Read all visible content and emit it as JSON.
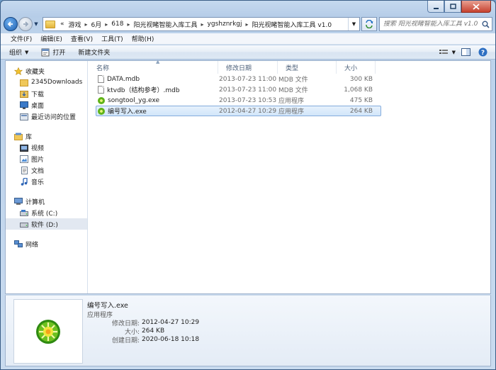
{
  "address": {
    "overflow": "«",
    "crumbs": [
      "游戏",
      "6月",
      "618",
      "阳光视睹智能入库工具",
      "ygshznrkgj",
      "阳光视睹智能入库工具 v1.0"
    ]
  },
  "search": {
    "placeholder": "搜索 阳光视睹智能入库工具 v1.0"
  },
  "menu": [
    "文件(F)",
    "编辑(E)",
    "查看(V)",
    "工具(T)",
    "帮助(H)"
  ],
  "toolbar": {
    "organize": "组织",
    "open": "打开",
    "new_folder": "新建文件夹"
  },
  "nav": {
    "favorites": {
      "label": "收藏夹",
      "items": [
        "2345Downloads",
        "下载",
        "桌面",
        "最近访问的位置"
      ]
    },
    "libraries": {
      "label": "库",
      "items": [
        "视频",
        "图片",
        "文档",
        "音乐"
      ]
    },
    "computer": {
      "label": "计算机",
      "items": [
        "系统 (C:)",
        "软件 (D:)"
      ]
    },
    "network": {
      "label": "网络"
    }
  },
  "columns": {
    "name": "名称",
    "date": "修改日期",
    "type": "类型",
    "size": "大小"
  },
  "files": [
    {
      "name": "DATA.mdb",
      "date": "2013-07-23 11:00",
      "type": "MDB 文件",
      "size": "300 KB",
      "icon": "document-icon"
    },
    {
      "name": "ktvdb（结构参考）.mdb",
      "date": "2013-07-23 11:00",
      "type": "MDB 文件",
      "size": "1,068 KB",
      "icon": "document-icon"
    },
    {
      "name": "songtool_yg.exe",
      "date": "2013-07-23 10:53",
      "type": "应用程序",
      "size": "475 KB",
      "icon": "exe-icon"
    },
    {
      "name": "编号写入.exe",
      "date": "2012-04-27 10:29",
      "type": "应用程序",
      "size": "264 KB",
      "icon": "exe-icon"
    }
  ],
  "details": {
    "name": "编号写入.exe",
    "type": "应用程序",
    "props": [
      {
        "label": "修改日期:",
        "value": "2012-04-27 10:29"
      },
      {
        "label": "大小:",
        "value": "264 KB"
      },
      {
        "label": "创建日期:",
        "value": "2020-06-18 10:18"
      }
    ]
  },
  "colors": {
    "selection": "#d2e6fa",
    "selection_border": "#84acdd",
    "frame": "#bcd2eb"
  }
}
